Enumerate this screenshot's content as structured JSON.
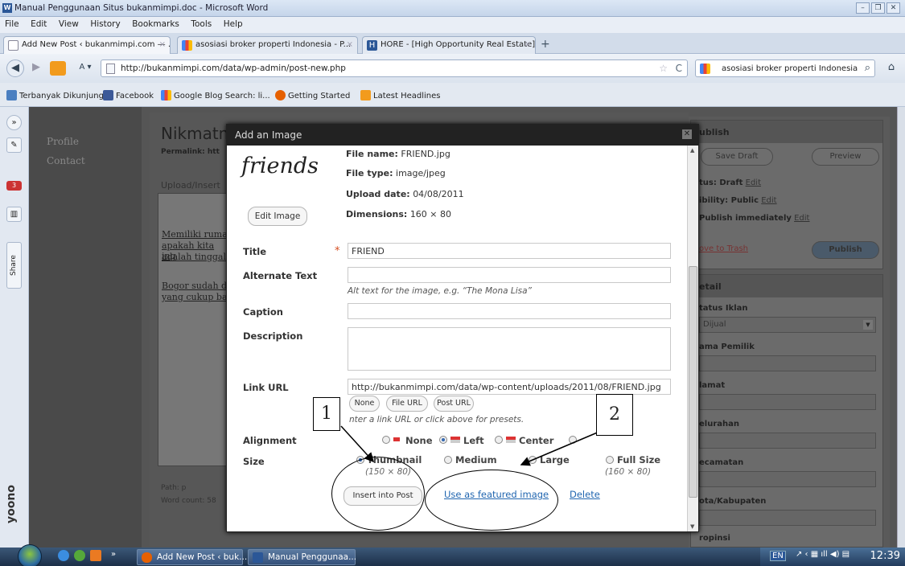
{
  "word": {
    "title": "Manual Penggunaan Situs bukanmimpi.doc - Microsoft Word",
    "menu": [
      "File",
      "Edit",
      "View",
      "History",
      "Bookmarks",
      "Tools",
      "Help"
    ]
  },
  "tabs": [
    {
      "label": "Add New Post ‹ bukanmimpi.com — ...",
      "close": "×"
    },
    {
      "label": "asosiasi broker properti Indonesia - P...",
      "close": "×"
    },
    {
      "label": "HORE - [High Opportunity Real Estate]",
      "close": "×"
    }
  ],
  "new_tab": "+",
  "nav": {
    "url": "http://bukanmimpi.com/data/wp-admin/post-new.php",
    "search": "asosiasi broker properti Indonesia"
  },
  "bookmarks": [
    "Terbanyak Dikunjungi",
    "Facebook",
    "Google Blog Search: li...",
    "Getting Started",
    "Latest Headlines"
  ],
  "sidebar_tools": {
    "share": "Share",
    "badge": "3"
  },
  "wp": {
    "menu": [
      "Profile",
      "Contact"
    ],
    "post_title": "Nikmatn",
    "permalink": "Permalink: htt",
    "upload_insert": "Upload/Insert",
    "editor_lines": [
      "Memiliki ruma",
      "apakah kita ing",
      "adalah tinggal",
      "Bogor sudah d",
      "yang cukup ba"
    ],
    "path": "Path: p",
    "word_count": "Word count: 58",
    "publish_title": "ublish",
    "save_draft": "Save Draft",
    "preview": "Preview",
    "status_line": "tus: Draft",
    "visibility_line": "ibility: Public",
    "publish_line": "Publish immediately",
    "edit": "Edit",
    "trash": "ove to Trash",
    "publish": "Publish",
    "detail_title": "etail",
    "fields": [
      "tatus Iklan",
      "ama Pemilik",
      "lamat",
      "elurahan",
      "ecamatan",
      "ota/Kabupaten",
      "ropinsi"
    ],
    "status_value": "Dijual"
  },
  "modal": {
    "title": "Add an Image",
    "thumb_text": "friends",
    "edit_image": "Edit Image",
    "file_name_label": "File name:",
    "file_name": "FRIEND.jpg",
    "file_type_label": "File type:",
    "file_type": "image/jpeg",
    "upload_date_label": "Upload date:",
    "upload_date": "04/08/2011",
    "dimensions_label": "Dimensions:",
    "dimensions": "160 × 80",
    "title_label": "Title",
    "required": "*",
    "title_value": "FRIEND",
    "alt_label": "Alternate Text",
    "alt_help": "Alt text for the image, e.g. “The Mona Lisa”",
    "caption_label": "Caption",
    "description_label": "Description",
    "link_label": "Link URL",
    "link_value": "http://bukanmimpi.com/data/wp-content/uploads/2011/08/FRIEND.jpg",
    "link_none": "None",
    "link_file": "File URL",
    "link_post": "Post URL",
    "link_help": "nter a link URL or click above for presets.",
    "alignment_label": "Alignment",
    "align_none": "None",
    "align_left": "Left",
    "align_center": "Center",
    "size_label": "Size",
    "size_thumbnail": "Thumbnail",
    "size_thumbnail_dim": "(150 × 80)",
    "size_medium": "Medium",
    "size_large": "Large",
    "size_full": "Full Size",
    "size_full_dim": "(160 × 80)",
    "insert": "Insert into Post",
    "featured": "Use as featured image",
    "delete": "Delete"
  },
  "annotations": {
    "one": "1",
    "two": "2"
  },
  "taskbar": {
    "items": [
      "Add New Post ‹ buk...",
      "Manual Penggunaa..."
    ],
    "lang": "EN",
    "clock": "12:39"
  }
}
